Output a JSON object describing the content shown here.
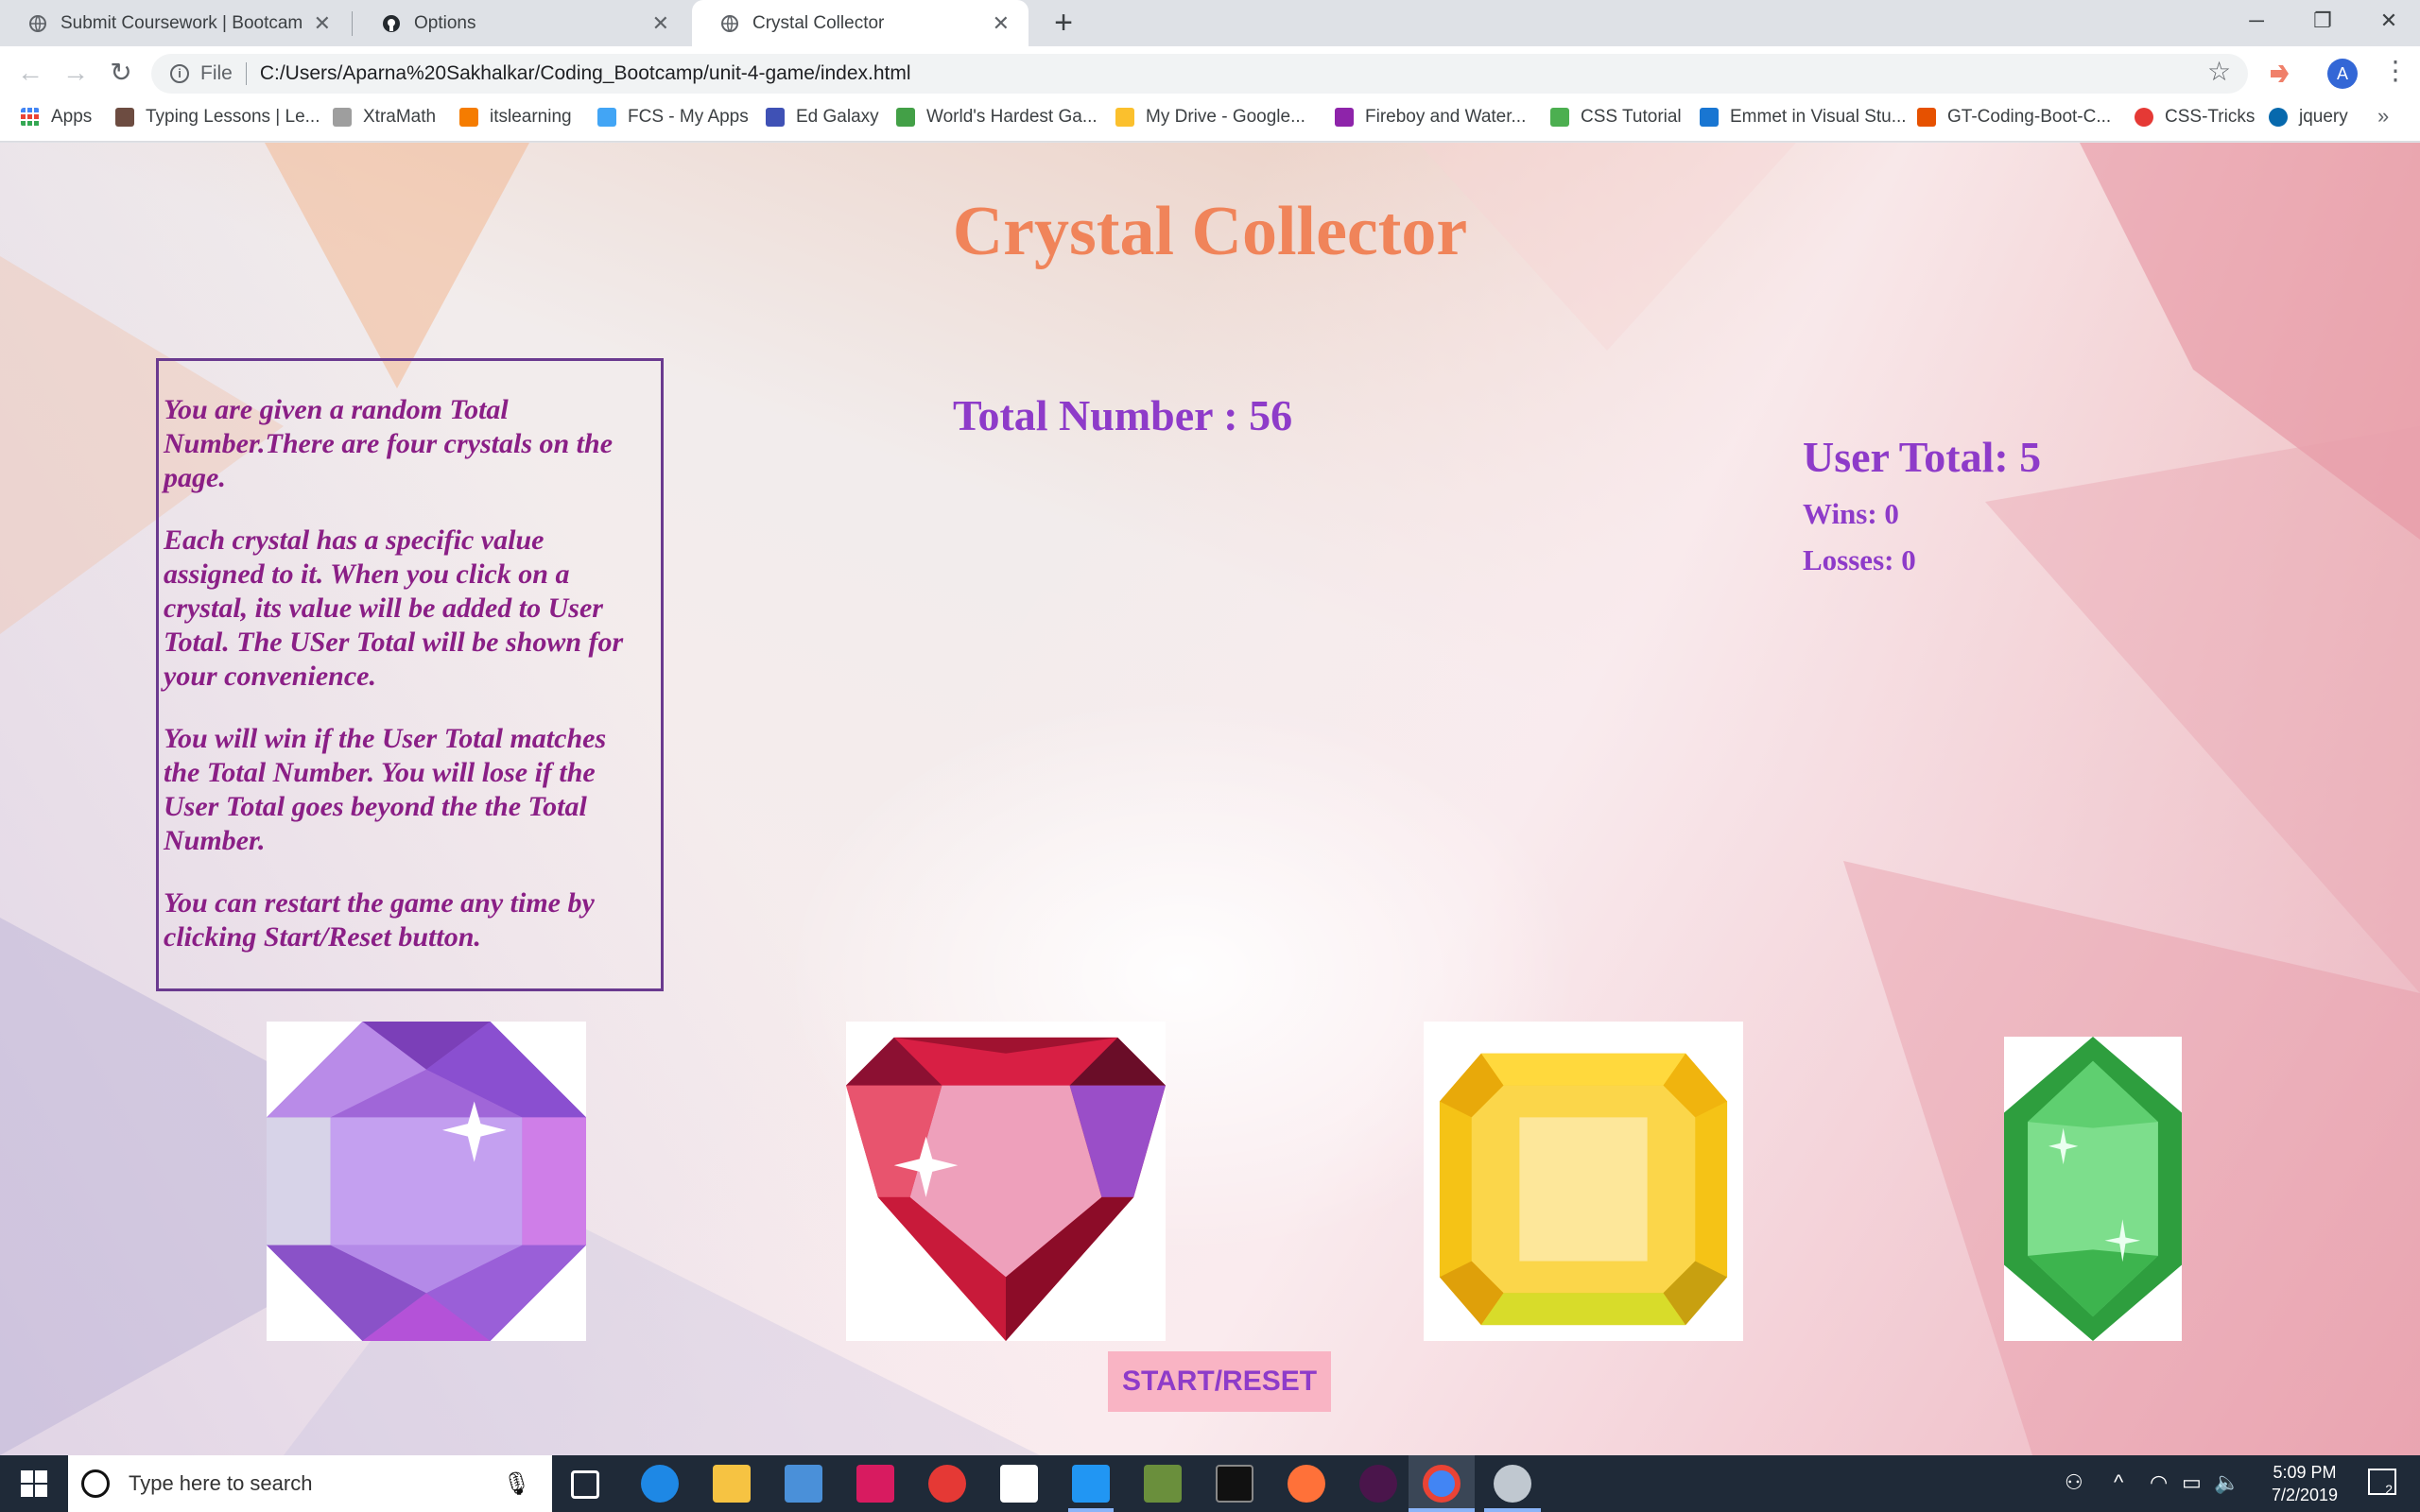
{
  "browser": {
    "tabs": [
      {
        "title": "Submit Coursework | Bootcamp S",
        "active": false
      },
      {
        "title": "Options",
        "active": false
      },
      {
        "title": "Crystal Collector",
        "active": true
      }
    ],
    "address": {
      "scheme_label": "File",
      "url": "C:/Users/Aparna%20Sakhalkar/Coding_Bootcamp/unit-4-game/index.html"
    },
    "profile_initial": "A",
    "bookmarks": [
      {
        "label": "Apps",
        "color": "#4285f4"
      },
      {
        "label": "Typing Lessons | Le...",
        "color": "#6d4c41"
      },
      {
        "label": "XtraMath",
        "color": "#9e9e9e"
      },
      {
        "label": "itslearning",
        "color": "#f57c00"
      },
      {
        "label": "FCS - My Apps",
        "color": "#42a5f5"
      },
      {
        "label": "Ed Galaxy",
        "color": "#3f51b5"
      },
      {
        "label": "World's Hardest Ga...",
        "color": "#43a047"
      },
      {
        "label": "My Drive - Google...",
        "color": "#fbc02d"
      },
      {
        "label": "Fireboy and Water...",
        "color": "#8e24aa"
      },
      {
        "label": "CSS Tutorial",
        "color": "#4caf50"
      },
      {
        "label": "Emmet in Visual Stu...",
        "color": "#1976d2"
      },
      {
        "label": "GT-Coding-Boot-C...",
        "color": "#e65100"
      },
      {
        "label": "CSS-Tricks",
        "color": "#e53935"
      },
      {
        "label": "jquery",
        "color": "#0769ad"
      }
    ]
  },
  "game": {
    "title": "Crystal Collector",
    "instructions": [
      "You are given a random Total Number.There are four crystals on the page.",
      "Each crystal has a specific value assigned to it. When you click on a crystal, its value will be added to User Total. The USer Total will be shown for your convenience.",
      "You will win if the User Total matches the Total Number. You will lose if the User Total goes beyond the the Total Number.",
      "You can restart the game any time by clicking Start/Reset button."
    ],
    "total_number_text": "Total Number : 56",
    "user_total_text": "User Total: 5",
    "wins_text": "Wins: 0",
    "losses_text": "Losses: 0",
    "crystals": [
      {
        "name": "purple-crystal",
        "color": "#a66be0"
      },
      {
        "name": "red-crystal",
        "color": "#e0284a"
      },
      {
        "name": "yellow-crystal",
        "color": "#f5c316"
      },
      {
        "name": "green-crystal",
        "color": "#2e9e3e"
      }
    ],
    "start_reset_label": "START/RESET"
  },
  "taskbar": {
    "search_placeholder": "Type here to search",
    "time": "5:09 PM",
    "date": "7/2/2019",
    "notification_count": "2"
  }
}
